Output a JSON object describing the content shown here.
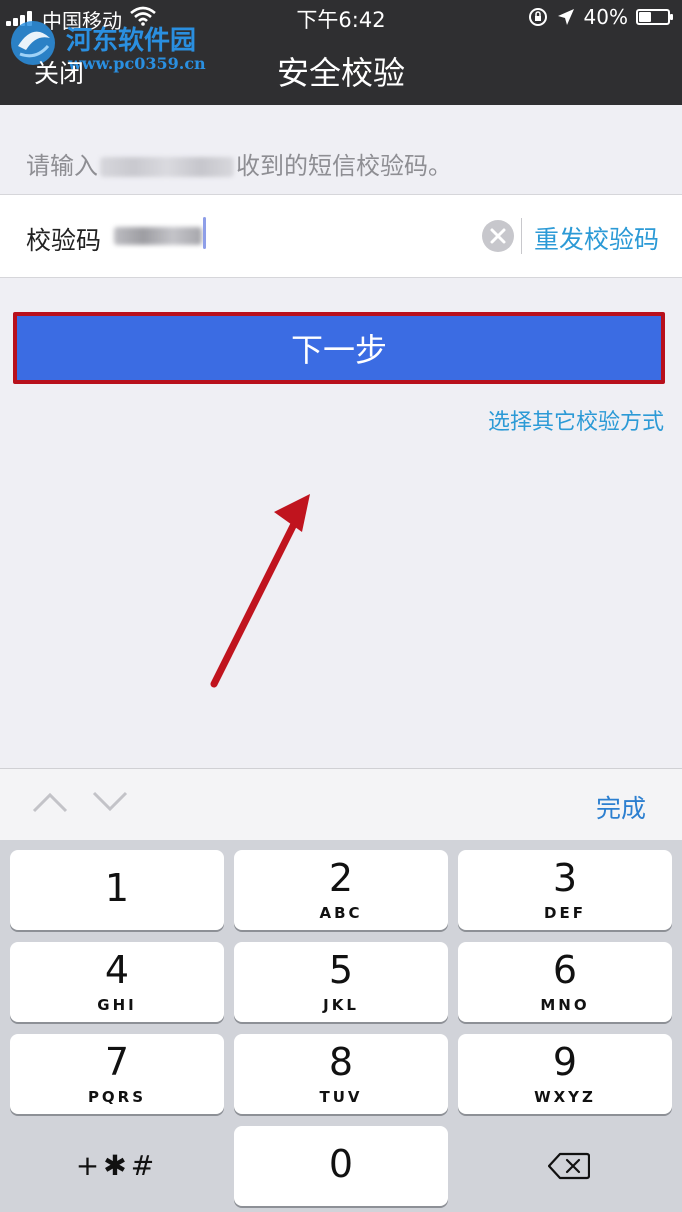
{
  "status": {
    "carrier": "中国移动",
    "time": "下午6:42",
    "battery": "40%",
    "battery_level": 0.4
  },
  "watermark": {
    "title": "河东软件园",
    "url": "www.pc0359.cn"
  },
  "nav": {
    "close_label": "关闭",
    "title": "安全校验"
  },
  "form": {
    "hint_prefix": "请输入",
    "hint_suffix": "收到的短信校验码。",
    "code_label": "校验码",
    "resend_label": "重发校验码"
  },
  "actions": {
    "next_label": "下一步",
    "other_method_label": "选择其它校验方式"
  },
  "keyboard": {
    "done_label": "完成",
    "keys": [
      {
        "num": "1",
        "letters": ""
      },
      {
        "num": "2",
        "letters": "ABC"
      },
      {
        "num": "3",
        "letters": "DEF"
      },
      {
        "num": "4",
        "letters": "GHI"
      },
      {
        "num": "5",
        "letters": "JKL"
      },
      {
        "num": "6",
        "letters": "MNO"
      },
      {
        "num": "7",
        "letters": "PQRS"
      },
      {
        "num": "8",
        "letters": "TUV"
      },
      {
        "num": "9",
        "letters": "WXYZ"
      },
      {
        "num": "0",
        "letters": ""
      }
    ],
    "symbols_label": "+✱#"
  },
  "colors": {
    "nav_bg": "#2f2f31",
    "accent": "#2c9ad6",
    "button": "#3b6ce3",
    "highlight": "#b8101c"
  }
}
